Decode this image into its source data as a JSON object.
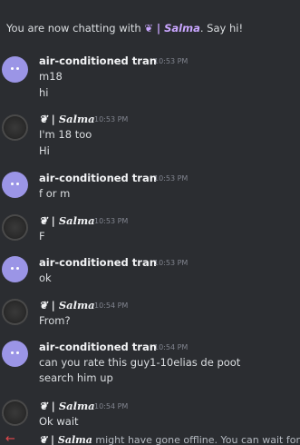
{
  "banner": {
    "prefix": "You are now chatting with ",
    "partner": "❦ | Salma",
    "suffix": ". Say hi!"
  },
  "messages": [
    {
      "author": "air-conditioned tran",
      "time": "10:53 PM",
      "lines": [
        "m18",
        "hi"
      ]
    },
    {
      "author": "❦ | Salma",
      "time": "10:53 PM",
      "lines": [
        "I'm 18 too",
        "Hi"
      ]
    },
    {
      "author": "air-conditioned tran",
      "time": "10:53 PM",
      "lines": [
        "f or m"
      ]
    },
    {
      "author": "❦ | Salma",
      "time": "10:53 PM",
      "lines": [
        "F"
      ]
    },
    {
      "author": "air-conditioned tran",
      "time": "10:53 PM",
      "lines": [
        "ok"
      ]
    },
    {
      "author": "❦ | Salma",
      "time": "10:54 PM",
      "lines": [
        "From?"
      ]
    },
    {
      "author": "air-conditioned tran",
      "time": "10:54 PM",
      "lines": [
        "can you rate this guy1-10elias de poot",
        "search him up"
      ]
    },
    {
      "author": "❦ | Salma",
      "time": "10:54 PM",
      "lines": [
        "Ok wait"
      ]
    }
  ],
  "footer": {
    "arrow": "←",
    "partner": "❦ | Salma",
    "text": " might have gone offline. You can wait for t"
  }
}
